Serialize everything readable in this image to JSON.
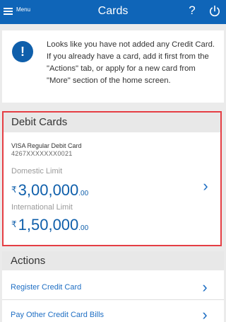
{
  "app_bar": {
    "menu_label": "Menu",
    "title": "Cards",
    "help_label": "?"
  },
  "notice": {
    "icon_glyph": "!",
    "message": "Looks like you have not added any Credit Card. If you already have a card, add it first from the \"Actions\" tab, or apply for a new card from \"More\" section of the home screen."
  },
  "debit_cards": {
    "header": "Debit Cards",
    "card_name": "VISA Regular Debit Card",
    "card_number_masked": "4267XXXXXXX0021",
    "domestic": {
      "label": "Domestic Limit",
      "currency": "₹",
      "amount": "3,00,000",
      "decimal": ".00"
    },
    "international": {
      "label": "International Limit",
      "currency": "₹",
      "amount": "1,50,000",
      "decimal": ".00"
    }
  },
  "actions": {
    "header": "Actions",
    "items": [
      {
        "label": "Register Credit Card"
      },
      {
        "label": "Pay Other Credit Card Bills"
      }
    ]
  },
  "colors": {
    "app_bar": "#0f65b8",
    "accent": "#1f6fc4",
    "highlight_border": "#e53e44"
  }
}
